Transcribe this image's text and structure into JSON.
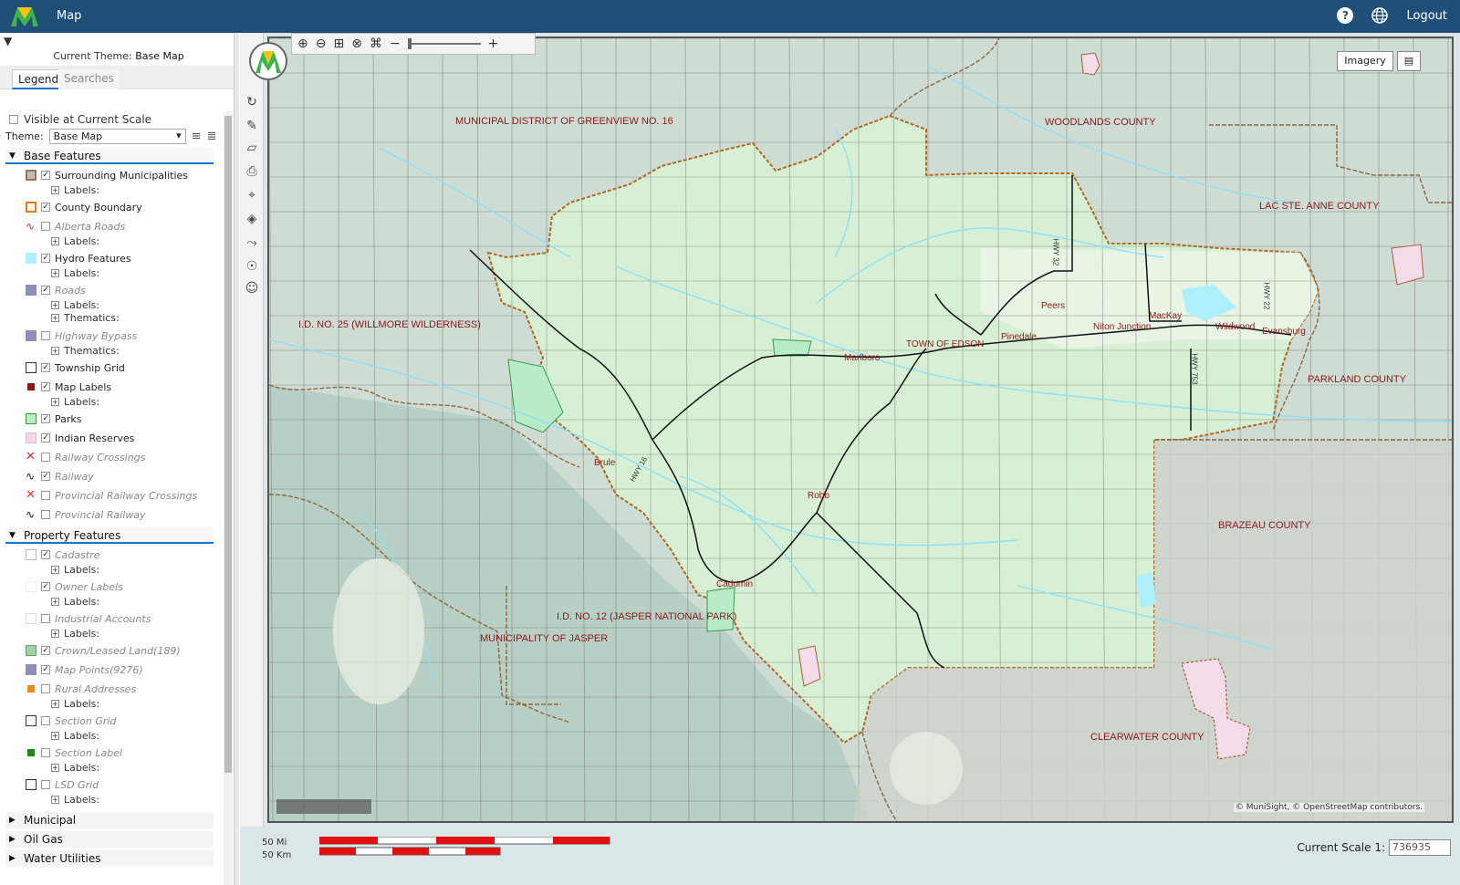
{
  "header": {
    "title": "Map",
    "help": "?",
    "logout": "Logout"
  },
  "panel": {
    "current_theme_label": "Current Theme:",
    "current_theme_value": "Base Map",
    "tabs": [
      "Legend",
      "Searches"
    ],
    "visible_label": "Visible at Current Scale",
    "theme_label": "Theme:",
    "theme_value": "Base Map",
    "sections": {
      "base": "Base Features",
      "property": "Property Features",
      "municipal": "Municipal",
      "oilgas": "Oil Gas",
      "water": "Water Utilities"
    },
    "labels_text": "Labels:",
    "thematics_text": "Thematics:",
    "layers": {
      "surrounding": "Surrounding Municipalities",
      "county_boundary": "County Boundary",
      "alberta_roads": "Alberta Roads",
      "hydro": "Hydro Features",
      "roads": "Roads",
      "highway_bypass": "Highway Bypass",
      "township_grid": "Township Grid",
      "map_labels": "Map Labels",
      "parks": "Parks",
      "indian_reserves": "Indian Reserves",
      "railway_crossings": "Railway Crossings",
      "railway": "Railway",
      "prov_railway_crossings": "Provincial Railway Crossings",
      "prov_railway": "Provincial Railway",
      "cadastre": "Cadastre",
      "owner_labels": "Owner Labels",
      "industrial_accounts": "Industrial Accounts",
      "crown_land": "Crown/Leased Land(189)",
      "map_points": "Map Points(9276)",
      "rural_addresses": "Rural Addresses",
      "section_grid": "Section Grid",
      "section_label": "Section Label",
      "lsd_grid": "LSD Grid"
    }
  },
  "map": {
    "imagery_btn": "Imagery",
    "attribution": "© MuniSight, © OpenStreetMap contributors.",
    "labels": {
      "greenview": "MUNICIPAL DISTRICT OF GREENVIEW NO. 16",
      "woodlands": "WOODLANDS COUNTY",
      "lacsteanne": "LAC STE. ANNE COUNTY",
      "willmore": "I.D. NO. 25 (WILLMORE WILDERNESS)",
      "parkland": "PARKLAND COUNTY",
      "brazeau": "BRAZEAU COUNTY",
      "jasper_np": "I.D. NO. 12 (JASPER NATIONAL PARK)",
      "jasper_muni": "MUNICIPALITY OF JASPER",
      "clearwater": "CLEARWATER COUNTY",
      "edson": "TOWN OF EDSON",
      "peers": "Peers",
      "pinedale": "Pinedale",
      "niton": "Niton Junction",
      "mackay": "MacKay",
      "wildwood": "Wildwood",
      "evansburg": "Evansburg",
      "marlboro": "Marlboro",
      "brule": "Brule",
      "robb": "Robb",
      "cadomin": "Cadomin",
      "hwy32": "HWY 32",
      "hwy22": "HWY 22",
      "hwy753": "HWY 753",
      "hwy16": "HWY 16"
    },
    "scale": {
      "mi": "50 Mi",
      "km": "50 Km",
      "current_label": "Current Scale 1:",
      "current_value": "736935"
    }
  }
}
